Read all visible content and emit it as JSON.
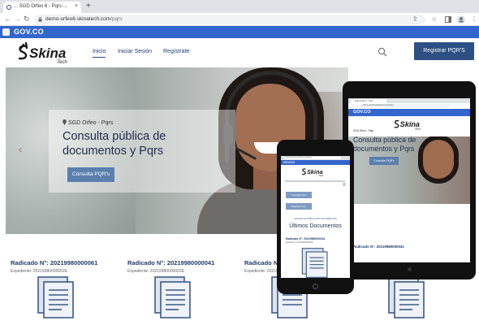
{
  "browser": {
    "tab_title": "... SGD Orfeo 6 - Pqrs ...",
    "new_tab": "+",
    "close_tab": "×",
    "url_host": "demo-orfeo6.skinatech.com",
    "url_path": "/pqrs"
  },
  "gov": {
    "label": "GOV.CO"
  },
  "header": {
    "logo_text": "Skina",
    "logo_sub": "Tech",
    "menu": [
      "Inicio",
      "Iniciar Sesión",
      "Regístrate"
    ],
    "register_button": "Registrar PQR'S"
  },
  "hero": {
    "small_label": "SGD Orfeo - Pqrs",
    "title": "Consulta pública de documentos y Pqrs",
    "button": "Consulta PQR's",
    "prev_arrow": "‹"
  },
  "records": [
    {
      "title": "Radicado N°: 20219980000061",
      "expediente": "Expediente: 20219980000002E"
    },
    {
      "title": "Radicado N°: 20219980000041",
      "expediente": "Expediente: 20219980000002E"
    },
    {
      "title": "Radicado N°: 20219980000041",
      "expediente": "Expediente: 20219980000002E"
    }
  ],
  "tablet": {
    "tab_title": "... SGD Orfeo 6 - Pqrs ...",
    "url": "demo-orfeo6.skinatech.com/pqrs",
    "gov": "GOV.CO",
    "small_label": "SGD Orfeo - Pqrs",
    "title": "Consulta pública de documentos y Pqrs",
    "button": "Consulta PQR's",
    "record": "Radicado N°: 20219980000041"
  },
  "phone": {
    "url": "demo-orfeo6.skinatech.com/pqrs",
    "gov": "GOV.CO",
    "hamburger": "≡",
    "button1": "Consulta Pqrs",
    "button2": "Registrar Pqrs",
    "section_label": "CONSULTA PÚBLICA DE DOCUMENTOS",
    "heading": "Últimos Documentos",
    "record": "Radicado N°: 20219980000041",
    "expediente": "Expediente: 20219980000002E"
  },
  "colors": {
    "gov_blue": "#3366cc",
    "primary": "#2c4f84",
    "hero_button": "#5b7fad",
    "nav_text": "#1f3b6a"
  },
  "icons": [
    "back-icon",
    "forward-icon",
    "reload-icon",
    "lock-icon",
    "share-icon",
    "star-icon",
    "sidebar-icon",
    "profile-icon",
    "menu-dots-icon",
    "search-icon",
    "document-icon",
    "map-pin-icon"
  ]
}
